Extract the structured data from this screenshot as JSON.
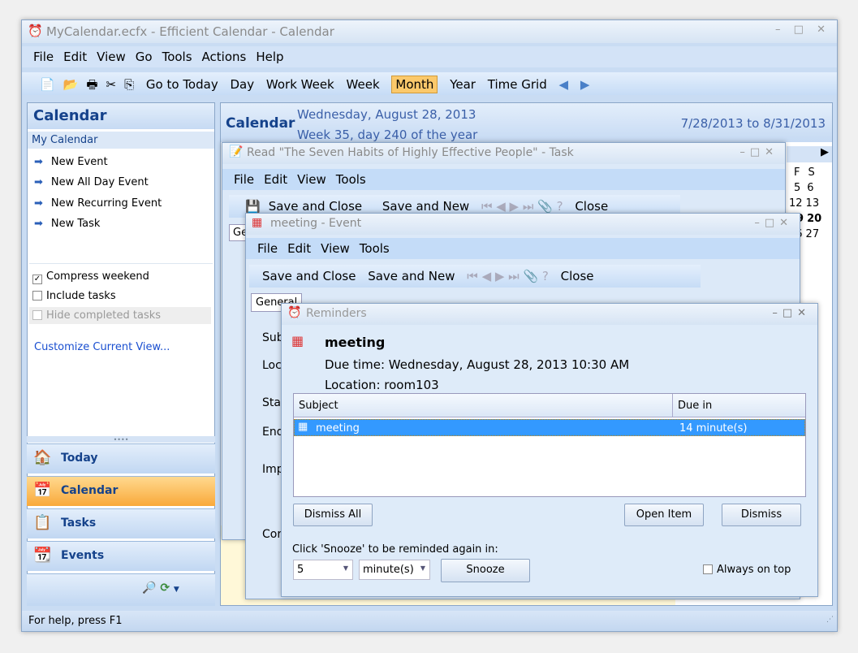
{
  "window": {
    "title": "MyCalendar.ecfx - Efficient Calendar - Calendar",
    "controls": "– □ ✕"
  },
  "menu": [
    "File",
    "Edit",
    "View",
    "Go",
    "Tools",
    "Actions",
    "Help"
  ],
  "toolbar": {
    "goto_today": "Go to Today",
    "views": [
      "Day",
      "Work Week",
      "Week",
      "Month",
      "Year",
      "Time Grid"
    ],
    "active_view": "Month",
    "prev": "◀",
    "next": "▶"
  },
  "sidebar": {
    "title": "Calendar",
    "section": "My Calendar",
    "links": [
      "New Event",
      "New All Day Event",
      "New Recurring Event",
      "New Task"
    ],
    "options": [
      {
        "label": "Compress weekend",
        "checked": true
      },
      {
        "label": "Include tasks",
        "checked": false
      },
      {
        "label": "Hide completed tasks",
        "checked": false,
        "disabled": true
      }
    ],
    "customize": "Customize Current View...",
    "nav": [
      {
        "label": "Today",
        "icon": "🏠"
      },
      {
        "label": "Calendar",
        "icon": "📅"
      },
      {
        "label": "Tasks",
        "icon": "📋"
      },
      {
        "label": "Events",
        "icon": "📆"
      }
    ]
  },
  "main": {
    "title": "Calendar",
    "date": "Wednesday, August 28, 2013",
    "week": "Week 35, day 240 of the year",
    "range": "7/28/2013 to 8/31/2013",
    "mini": {
      "headers": [
        "F",
        "S"
      ],
      "rows": [
        [
          "5",
          "6"
        ],
        [
          "12",
          "13"
        ],
        [
          "19",
          "20"
        ],
        [
          "26",
          "27"
        ]
      ]
    }
  },
  "task_window": {
    "title": "Read \"The Seven Habits of Highly Effective People\" - Task",
    "menu": [
      "File",
      "Edit",
      "View",
      "Tools"
    ],
    "save_close": "Save and Close",
    "save_new": "Save and New",
    "close": "Close",
    "tab": "Ge"
  },
  "event_window": {
    "title": "meeting - Event",
    "menu": [
      "File",
      "Edit",
      "View",
      "Tools"
    ],
    "save_close": "Save and Close",
    "save_new": "Save and New",
    "close": "Close",
    "tab": "General",
    "labels": [
      "Sub",
      "Loc",
      "Sta",
      "End",
      "Imp",
      "Cor"
    ]
  },
  "reminders": {
    "title": "Reminders",
    "subject": "meeting",
    "due_time": "Due time: Wednesday, August 28, 2013 10:30 AM",
    "location": "Location: room103",
    "columns": [
      "Subject",
      "Due in"
    ],
    "rows": [
      {
        "subject": "meeting",
        "due": "14 minute(s)"
      }
    ],
    "dismiss_all": "Dismiss All",
    "open_item": "Open Item",
    "dismiss": "Dismiss",
    "snooze_prompt": "Click 'Snooze' to be reminded again in:",
    "snooze_value": "5",
    "snooze_unit": "minute(s)",
    "snooze": "Snooze",
    "always_on_top": "Always on top",
    "selection_color": "#3399ff"
  },
  "status": "For help, press F1"
}
